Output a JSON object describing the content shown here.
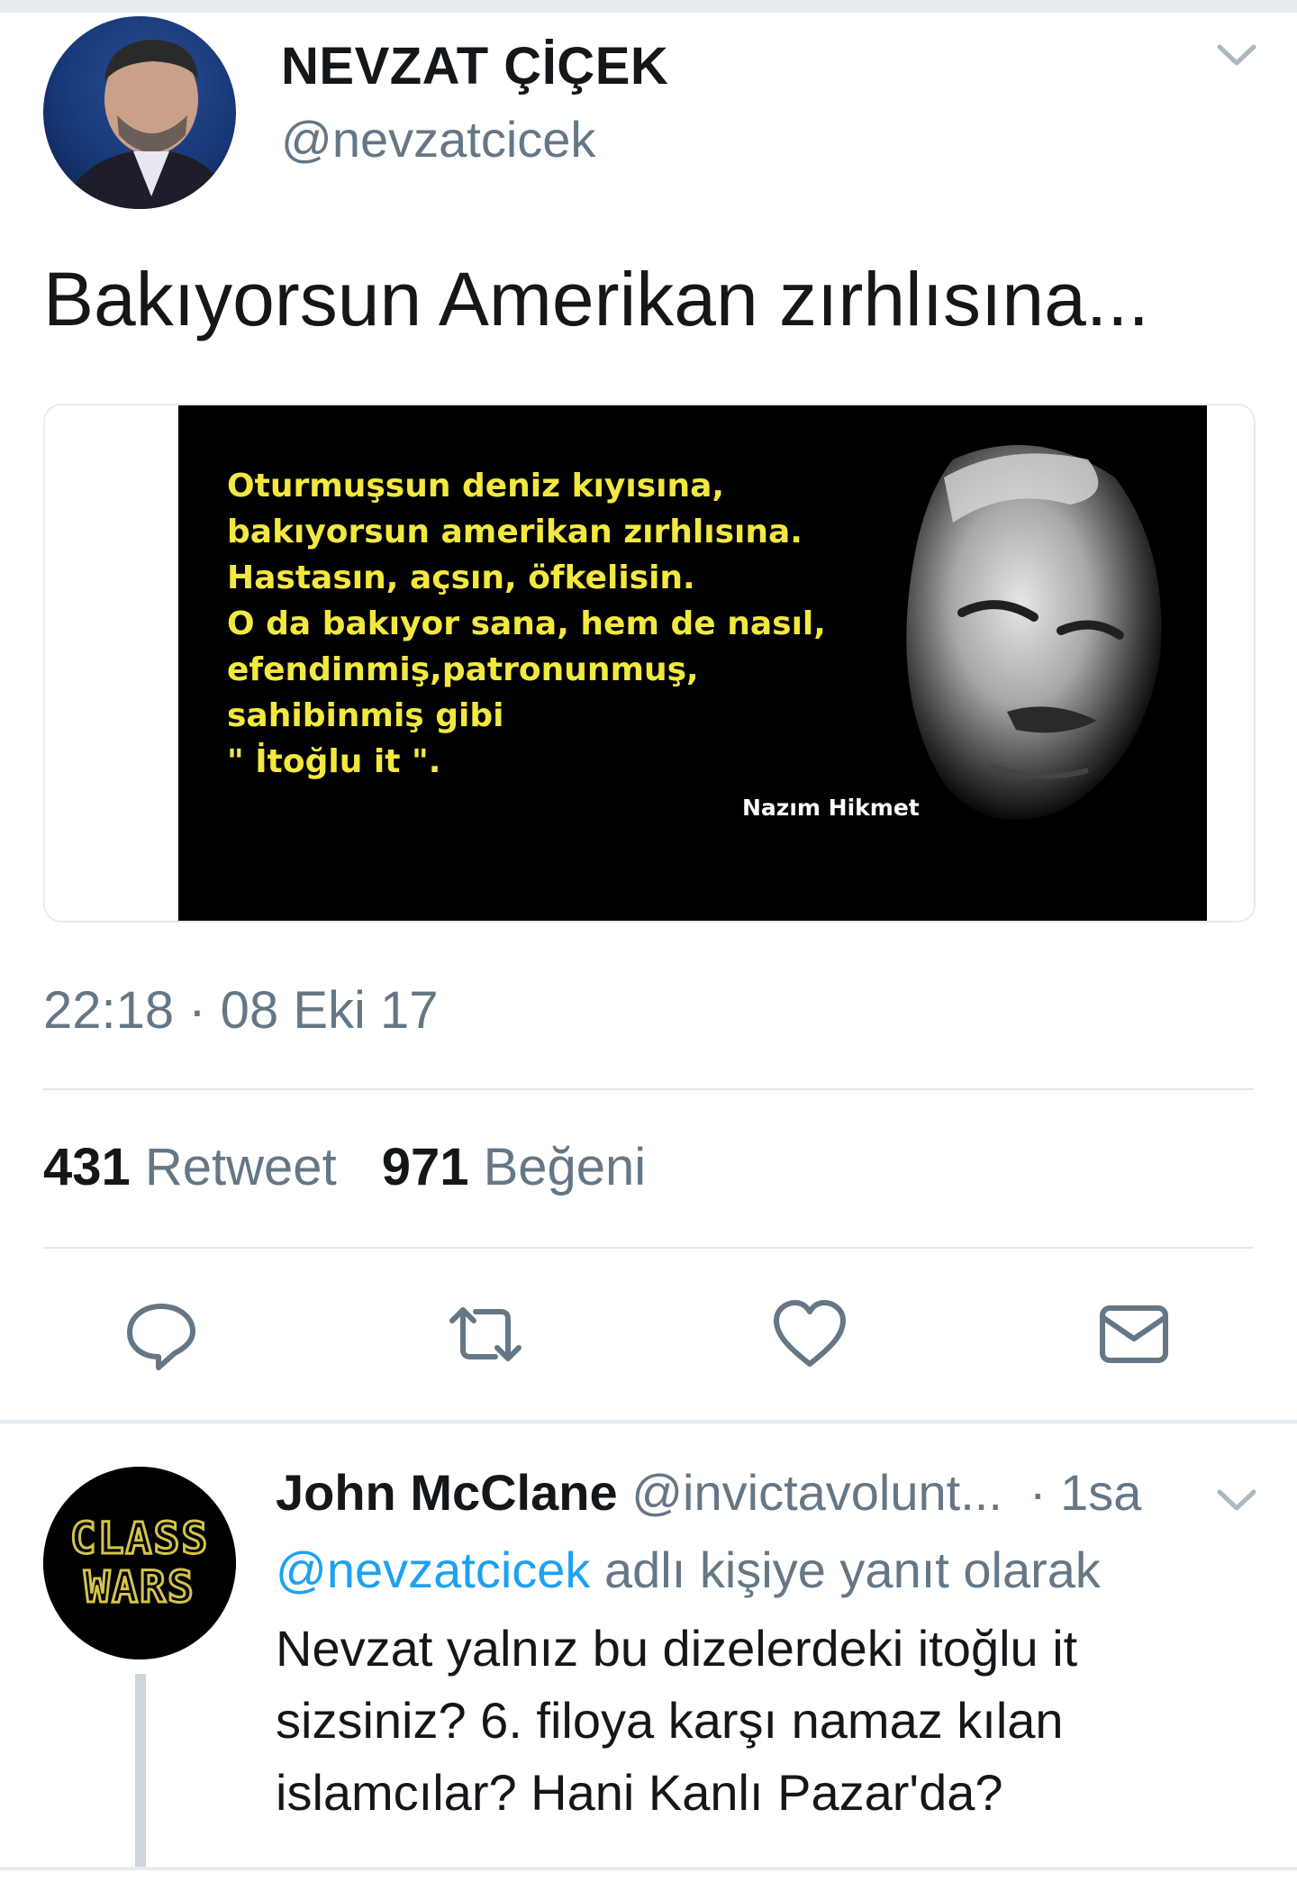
{
  "tweet": {
    "display_name": "NEVZAT ÇİÇEK",
    "handle": "@nevzatcicek",
    "text": "Bakıyorsun Amerikan zırhlısına...",
    "media": {
      "poem_lines": [
        "Oturmuşsun deniz kıyısına,",
        "bakıyorsun amerikan zırhlısına.",
        "Hastasın, açsın, öfkelisin.",
        "O da bakıyor sana, hem de nasıl,",
        "efendinmiş,patronunmuş,",
        "sahibinmiş gibi",
        "\" İtoğlu it \"."
      ],
      "author": "Nazım Hikmet"
    },
    "timestamp": "22:18 · 08 Eki 17",
    "retweet_count": "431",
    "retweet_label": "Retweet",
    "like_count": "971",
    "like_label": "Beğeni",
    "actions": [
      "reply-icon",
      "retweet-icon",
      "heart-icon",
      "mail-icon"
    ]
  },
  "reply": {
    "display_name": "John McClane",
    "handle": "@invictavolunt...",
    "time": "1sa",
    "in_reply_to_mention": "@nevzatcicek",
    "in_reply_to_suffix": " adlı kişiye yanıt olarak",
    "text": "Nevzat yalnız bu dizelerdeki itoğlu it sizsiniz? 6. filoya karşı namaz kılan islamcılar? Hani Kanlı Pazar'da?",
    "avatar_text_line1": "CLASS",
    "avatar_text_line2": "WARS"
  },
  "colors": {
    "primary_text": "#14171a",
    "secondary_text": "#657786",
    "link": "#1da1f2",
    "divider": "#e1e8ed",
    "poem_yellow": "#f2e840"
  }
}
